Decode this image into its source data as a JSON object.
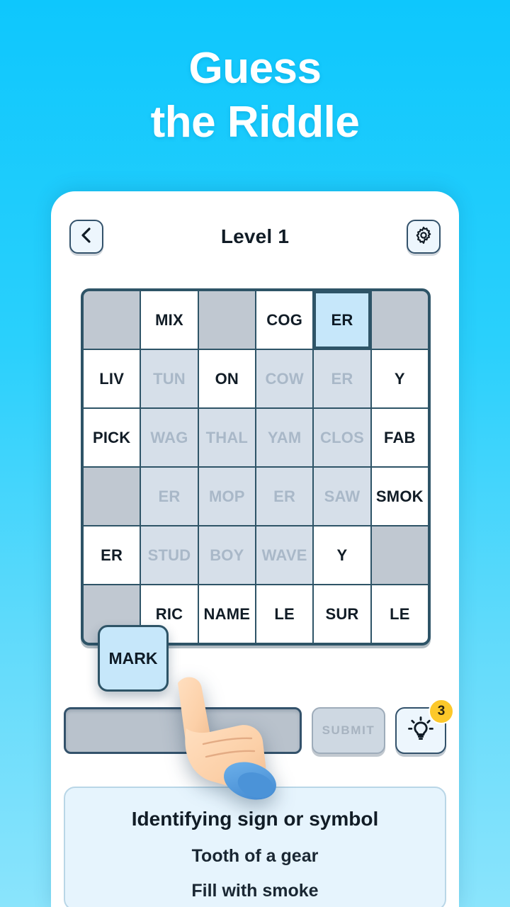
{
  "hero": {
    "line1": "Guess",
    "line2": "the Riddle"
  },
  "topbar": {
    "back_icon": "chevron-left-icon",
    "title": "Level 1",
    "settings_icon": "gear-icon"
  },
  "grid": {
    "rows": [
      [
        {
          "text": "",
          "state": "blocked"
        },
        {
          "text": "MIX",
          "state": "placed"
        },
        {
          "text": "",
          "state": "blocked"
        },
        {
          "text": "COG",
          "state": "placed"
        },
        {
          "text": "ER",
          "state": "selected"
        },
        {
          "text": "",
          "state": "blocked"
        }
      ],
      [
        {
          "text": "LIV",
          "state": "placed"
        },
        {
          "text": "TUN",
          "state": "faded"
        },
        {
          "text": "ON",
          "state": "placed"
        },
        {
          "text": "COW",
          "state": "faded"
        },
        {
          "text": "ER",
          "state": "faded"
        },
        {
          "text": "Y",
          "state": "placed"
        }
      ],
      [
        {
          "text": "PICK",
          "state": "placed"
        },
        {
          "text": "WAG",
          "state": "faded"
        },
        {
          "text": "THAL",
          "state": "faded"
        },
        {
          "text": "YAM",
          "state": "faded"
        },
        {
          "text": "CLOS",
          "state": "faded"
        },
        {
          "text": "FAB",
          "state": "placed"
        }
      ],
      [
        {
          "text": "",
          "state": "blocked"
        },
        {
          "text": "ER",
          "state": "faded"
        },
        {
          "text": "MOP",
          "state": "faded"
        },
        {
          "text": "ER",
          "state": "faded"
        },
        {
          "text": "SAW",
          "state": "faded"
        },
        {
          "text": "SMOK",
          "state": "placed"
        }
      ],
      [
        {
          "text": "ER",
          "state": "placed"
        },
        {
          "text": "STUD",
          "state": "faded"
        },
        {
          "text": "BOY",
          "state": "faded"
        },
        {
          "text": "WAVE",
          "state": "faded"
        },
        {
          "text": "Y",
          "state": "placed"
        },
        {
          "text": "",
          "state": "blocked"
        }
      ],
      [
        {
          "text": "",
          "state": "blocked"
        },
        {
          "text": "RIC",
          "state": "placed"
        },
        {
          "text": "NAME",
          "state": "placed"
        },
        {
          "text": "LE",
          "state": "placed"
        },
        {
          "text": "SUR",
          "state": "placed"
        },
        {
          "text": "LE",
          "state": "placed"
        }
      ]
    ]
  },
  "drag_tile": {
    "label": "MARK"
  },
  "answer_row": {
    "input_value": "",
    "submit_label": "SUBMIT",
    "hint_icon": "lightbulb-icon",
    "hint_count": "3"
  },
  "clue": {
    "heading": "Identifying sign or symbol",
    "line1": "Tooth of a gear",
    "line2": "Fill with smoke"
  },
  "colors": {
    "bg_top": "#0ec7fd",
    "bg_bottom": "#8ae4fc",
    "grid_frame": "#2e5467",
    "cell_blocked": "#c0c8d1",
    "cell_faded": "#d6dfe9",
    "cell_selected": "#c6e7fa",
    "badge": "#fcc82a",
    "clue_panel": "#e6f4fd"
  }
}
